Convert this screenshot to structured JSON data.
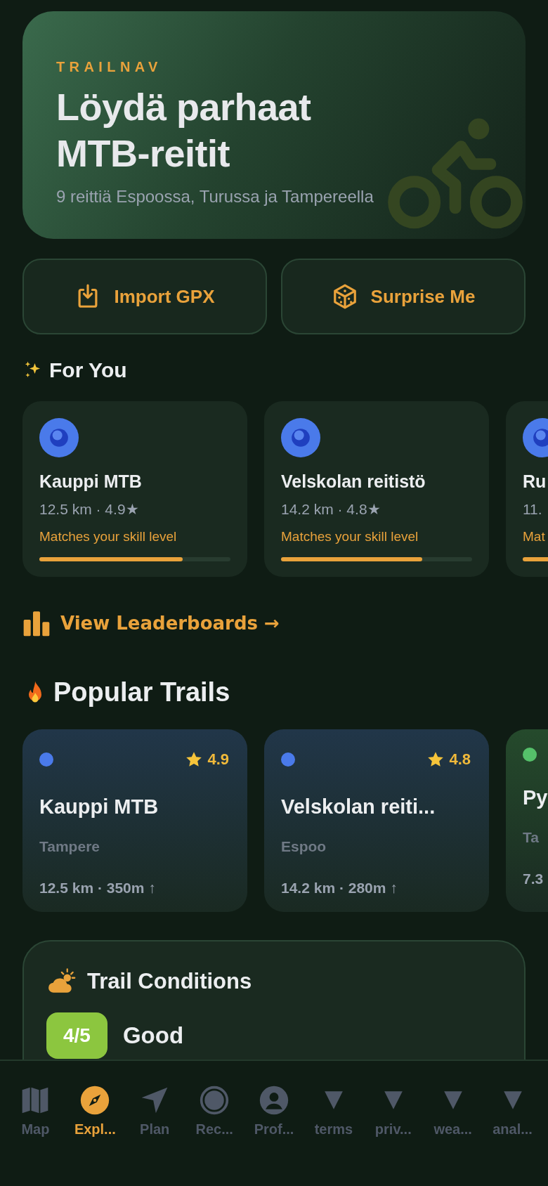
{
  "hero": {
    "brand": "TRAILNAV",
    "title": "Löydä parhaat MTB-reitit",
    "subtitle": "9 reittiä Espoossa, Turussa ja Tampereella"
  },
  "actions": [
    {
      "kind": "import",
      "label": "Import GPX"
    },
    {
      "kind": "dice",
      "label": "Surprise Me"
    }
  ],
  "for_you": {
    "heading": "For You",
    "cards": [
      {
        "name": "Kauppi MTB",
        "meta": "12.5 km · 4.9★",
        "reason": "Matches your skill level",
        "level": 0.75,
        "color": "#4a7aea"
      },
      {
        "name": "Velskolan reitistö",
        "meta": "14.2 km · 4.8★",
        "reason": "Matches your skill level",
        "level": 0.74,
        "color": "#4a7aea"
      },
      {
        "name": "Ru",
        "meta": "11.",
        "reason": "Mat",
        "color": "#4a7aea"
      }
    ]
  },
  "leaderboards_link": "View Leaderboards →",
  "popular": {
    "heading": "Popular Trails",
    "cards": [
      {
        "name": "Kauppi MTB",
        "city": "Tampere",
        "stats": "12.5 km · 350m ↑",
        "rating": "4.9",
        "color": "#4a7aea"
      },
      {
        "name": "Velskolan reiti...",
        "city": "Espoo",
        "stats": "14.2 km · 280m ↑",
        "rating": "4.8",
        "color": "#4a7aea"
      },
      {
        "name": "Py",
        "city": "Ta",
        "stats": "7.3",
        "color": "#55c06a"
      }
    ]
  },
  "conditions": {
    "title": "Trail Conditions",
    "score": "4/5",
    "label": "Good"
  },
  "nav": [
    {
      "kind": "map",
      "label": "Map",
      "selected": false
    },
    {
      "kind": "compass",
      "label": "Expl...",
      "selected": true
    },
    {
      "kind": "arrow",
      "label": "Plan",
      "selected": false
    },
    {
      "kind": "record",
      "label": "Rec...",
      "selected": false
    },
    {
      "kind": "person",
      "label": "Prof...",
      "selected": false
    },
    {
      "kind": "triangle",
      "label": "terms",
      "selected": false
    },
    {
      "kind": "triangle",
      "label": "priv...",
      "selected": false
    },
    {
      "kind": "triangle",
      "label": "wea...",
      "selected": false
    },
    {
      "kind": "triangle",
      "label": "anal...",
      "selected": false
    }
  ]
}
